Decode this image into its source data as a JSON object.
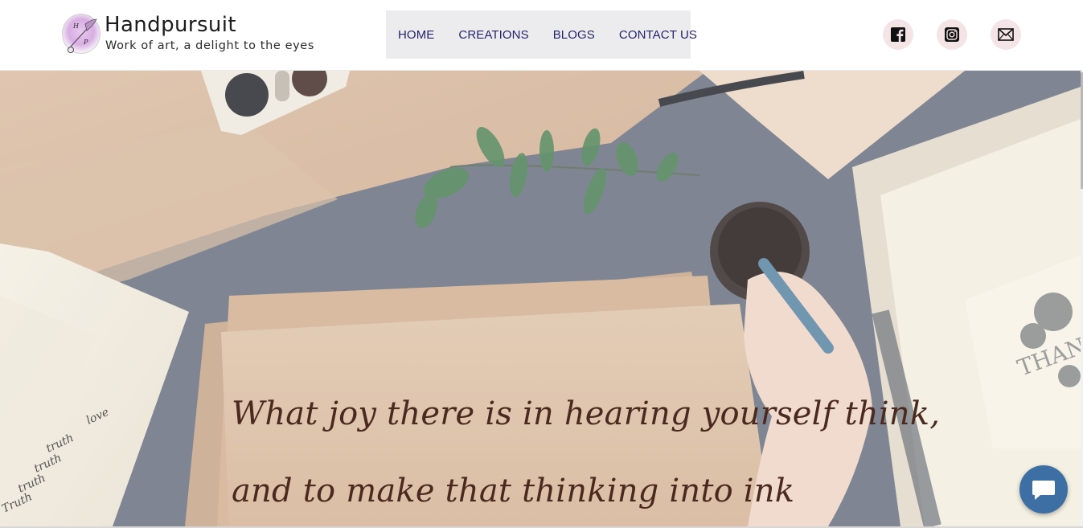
{
  "brand": {
    "title": "Handpursuit",
    "tagline": "Work of art, a delight to the eyes",
    "logo_letters": [
      "H",
      "P"
    ]
  },
  "nav": {
    "items": [
      {
        "label": "HOME"
      },
      {
        "label": "CREATIONS"
      },
      {
        "label": "BLOGS"
      },
      {
        "label": "CONTACT US"
      }
    ]
  },
  "social": {
    "icons": [
      "facebook-icon",
      "instagram-icon",
      "mail-icon"
    ]
  },
  "hero": {
    "quote_line1": "What joy there is in hearing yourself think,",
    "quote_line2": "and to make that thinking into ink",
    "card_text": "THAN",
    "handwriting": [
      "love",
      "truth",
      "truth",
      "truth",
      "Truth"
    ]
  },
  "chat": {
    "icon": "chat-bubble-icon"
  },
  "colors": {
    "nav_text": "#24246b",
    "nav_bg": "#ececef",
    "social_bg": "#f4e4e6",
    "quote_text": "#4a2a1e",
    "chat_bg": "#3d6fa4"
  }
}
